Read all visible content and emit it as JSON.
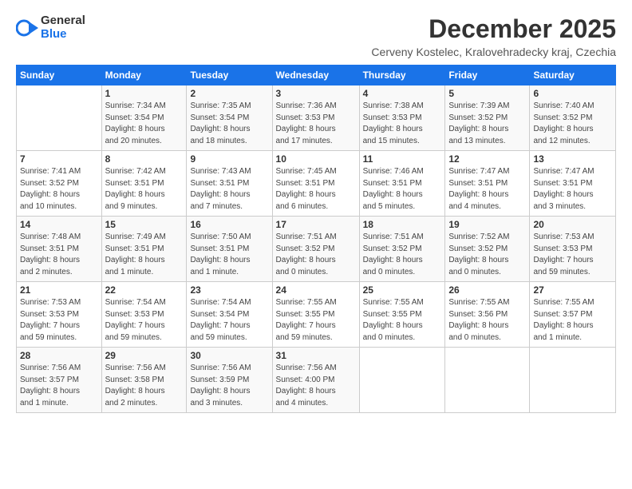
{
  "logo": {
    "general": "General",
    "blue": "Blue"
  },
  "title": "December 2025",
  "subtitle": "Cerveny Kostelec, Kralovehradecky kraj, Czechia",
  "days_of_week": [
    "Sunday",
    "Monday",
    "Tuesday",
    "Wednesday",
    "Thursday",
    "Friday",
    "Saturday"
  ],
  "weeks": [
    [
      {
        "num": "",
        "info": ""
      },
      {
        "num": "1",
        "info": "Sunrise: 7:34 AM\nSunset: 3:54 PM\nDaylight: 8 hours\nand 20 minutes."
      },
      {
        "num": "2",
        "info": "Sunrise: 7:35 AM\nSunset: 3:54 PM\nDaylight: 8 hours\nand 18 minutes."
      },
      {
        "num": "3",
        "info": "Sunrise: 7:36 AM\nSunset: 3:53 PM\nDaylight: 8 hours\nand 17 minutes."
      },
      {
        "num": "4",
        "info": "Sunrise: 7:38 AM\nSunset: 3:53 PM\nDaylight: 8 hours\nand 15 minutes."
      },
      {
        "num": "5",
        "info": "Sunrise: 7:39 AM\nSunset: 3:52 PM\nDaylight: 8 hours\nand 13 minutes."
      },
      {
        "num": "6",
        "info": "Sunrise: 7:40 AM\nSunset: 3:52 PM\nDaylight: 8 hours\nand 12 minutes."
      }
    ],
    [
      {
        "num": "7",
        "info": "Sunrise: 7:41 AM\nSunset: 3:52 PM\nDaylight: 8 hours\nand 10 minutes."
      },
      {
        "num": "8",
        "info": "Sunrise: 7:42 AM\nSunset: 3:51 PM\nDaylight: 8 hours\nand 9 minutes."
      },
      {
        "num": "9",
        "info": "Sunrise: 7:43 AM\nSunset: 3:51 PM\nDaylight: 8 hours\nand 7 minutes."
      },
      {
        "num": "10",
        "info": "Sunrise: 7:45 AM\nSunset: 3:51 PM\nDaylight: 8 hours\nand 6 minutes."
      },
      {
        "num": "11",
        "info": "Sunrise: 7:46 AM\nSunset: 3:51 PM\nDaylight: 8 hours\nand 5 minutes."
      },
      {
        "num": "12",
        "info": "Sunrise: 7:47 AM\nSunset: 3:51 PM\nDaylight: 8 hours\nand 4 minutes."
      },
      {
        "num": "13",
        "info": "Sunrise: 7:47 AM\nSunset: 3:51 PM\nDaylight: 8 hours\nand 3 minutes."
      }
    ],
    [
      {
        "num": "14",
        "info": "Sunrise: 7:48 AM\nSunset: 3:51 PM\nDaylight: 8 hours\nand 2 minutes."
      },
      {
        "num": "15",
        "info": "Sunrise: 7:49 AM\nSunset: 3:51 PM\nDaylight: 8 hours\nand 1 minute."
      },
      {
        "num": "16",
        "info": "Sunrise: 7:50 AM\nSunset: 3:51 PM\nDaylight: 8 hours\nand 1 minute."
      },
      {
        "num": "17",
        "info": "Sunrise: 7:51 AM\nSunset: 3:52 PM\nDaylight: 8 hours\nand 0 minutes."
      },
      {
        "num": "18",
        "info": "Sunrise: 7:51 AM\nSunset: 3:52 PM\nDaylight: 8 hours\nand 0 minutes."
      },
      {
        "num": "19",
        "info": "Sunrise: 7:52 AM\nSunset: 3:52 PM\nDaylight: 8 hours\nand 0 minutes."
      },
      {
        "num": "20",
        "info": "Sunrise: 7:53 AM\nSunset: 3:53 PM\nDaylight: 7 hours\nand 59 minutes."
      }
    ],
    [
      {
        "num": "21",
        "info": "Sunrise: 7:53 AM\nSunset: 3:53 PM\nDaylight: 7 hours\nand 59 minutes."
      },
      {
        "num": "22",
        "info": "Sunrise: 7:54 AM\nSunset: 3:53 PM\nDaylight: 7 hours\nand 59 minutes."
      },
      {
        "num": "23",
        "info": "Sunrise: 7:54 AM\nSunset: 3:54 PM\nDaylight: 7 hours\nand 59 minutes."
      },
      {
        "num": "24",
        "info": "Sunrise: 7:55 AM\nSunset: 3:55 PM\nDaylight: 7 hours\nand 59 minutes."
      },
      {
        "num": "25",
        "info": "Sunrise: 7:55 AM\nSunset: 3:55 PM\nDaylight: 8 hours\nand 0 minutes."
      },
      {
        "num": "26",
        "info": "Sunrise: 7:55 AM\nSunset: 3:56 PM\nDaylight: 8 hours\nand 0 minutes."
      },
      {
        "num": "27",
        "info": "Sunrise: 7:55 AM\nSunset: 3:57 PM\nDaylight: 8 hours\nand 1 minute."
      }
    ],
    [
      {
        "num": "28",
        "info": "Sunrise: 7:56 AM\nSunset: 3:57 PM\nDaylight: 8 hours\nand 1 minute."
      },
      {
        "num": "29",
        "info": "Sunrise: 7:56 AM\nSunset: 3:58 PM\nDaylight: 8 hours\nand 2 minutes."
      },
      {
        "num": "30",
        "info": "Sunrise: 7:56 AM\nSunset: 3:59 PM\nDaylight: 8 hours\nand 3 minutes."
      },
      {
        "num": "31",
        "info": "Sunrise: 7:56 AM\nSunset: 4:00 PM\nDaylight: 8 hours\nand 4 minutes."
      },
      {
        "num": "",
        "info": ""
      },
      {
        "num": "",
        "info": ""
      },
      {
        "num": "",
        "info": ""
      }
    ]
  ]
}
